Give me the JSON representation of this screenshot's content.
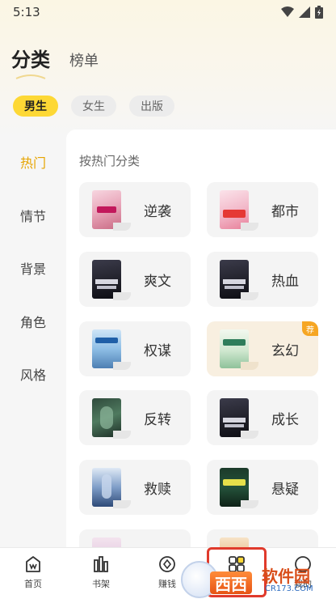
{
  "status_bar": {
    "time": "5:13"
  },
  "header": {
    "tabs": [
      {
        "label": "分类",
        "active": true
      },
      {
        "label": "榜单",
        "active": false
      }
    ]
  },
  "gender_filters": [
    {
      "label": "男生",
      "active": true
    },
    {
      "label": "女生",
      "active": false
    },
    {
      "label": "出版",
      "active": false
    }
  ],
  "side_nav": [
    {
      "label": "热门",
      "active": true
    },
    {
      "label": "情节",
      "active": false
    },
    {
      "label": "背景",
      "active": false
    },
    {
      "label": "角色",
      "active": false
    },
    {
      "label": "风格",
      "active": false
    }
  ],
  "panel": {
    "title": "按热门分类",
    "categories": [
      {
        "label": "逆袭",
        "cover": "cover-girl-comic"
      },
      {
        "label": "都市",
        "cover": "cover-pink-anime"
      },
      {
        "label": "爽文",
        "cover": "cover-dark-warrior"
      },
      {
        "label": "热血",
        "cover": "cover-dark-warrior"
      },
      {
        "label": "权谋",
        "cover": "cover-blue-sky"
      },
      {
        "label": "玄幻",
        "cover": "cover-green-light",
        "badge": "荐"
      },
      {
        "label": "反转",
        "cover": "cover-dark-green"
      },
      {
        "label": "成长",
        "cover": "cover-dark-warrior"
      },
      {
        "label": "救赎",
        "cover": "cover-blue-night"
      },
      {
        "label": "悬疑",
        "cover": "cover-dark-forest"
      }
    ]
  },
  "bottom_nav": [
    {
      "label": "首页",
      "icon": "home-icon"
    },
    {
      "label": "书架",
      "icon": "bookshelf-icon"
    },
    {
      "label": "赚钱",
      "icon": "coin-icon"
    },
    {
      "label": "分类",
      "icon": "category-icon",
      "active": true
    },
    {
      "label": "我的",
      "icon": "profile-icon"
    }
  ],
  "watermark": {
    "tag": "西西",
    "text": "软件园",
    "sub": "CR173.COM"
  },
  "colors": {
    "accent": "#fdd835",
    "active_text": "#e6a400",
    "highlight_border": "#e03a2c"
  }
}
